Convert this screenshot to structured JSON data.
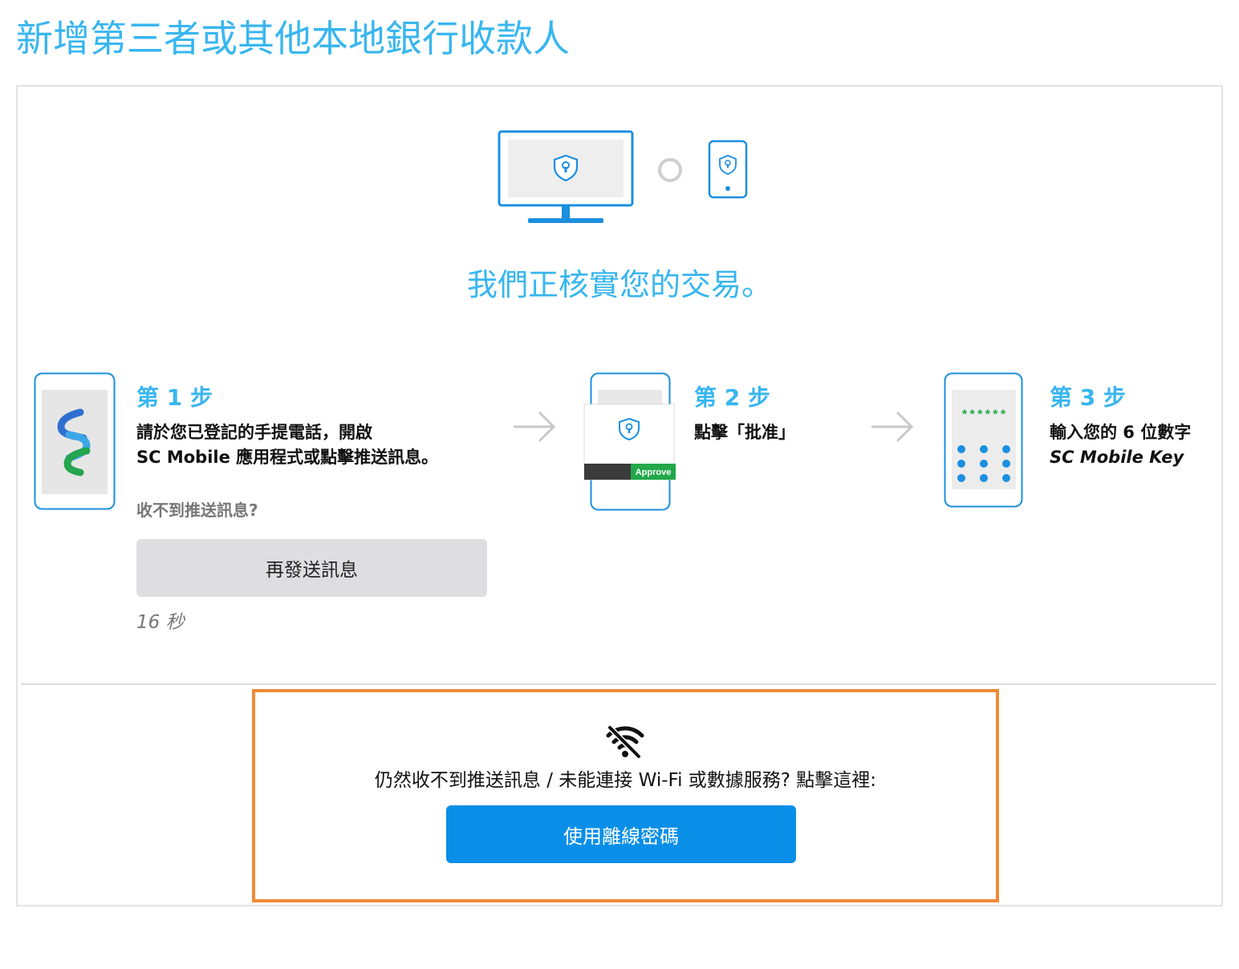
{
  "page": {
    "title": "新增第三者或其他本地銀行收款人"
  },
  "verification": {
    "heading": "我們正核實您的交易。"
  },
  "steps": [
    {
      "title": "第 1 步",
      "line1": "請於您已登記的手提電話，開啟",
      "line2": "SC Mobile 應用程式或點擊推送訊息。"
    },
    {
      "title": "第 2 步",
      "line1": "點擊「批准」",
      "approve_label": "Approve"
    },
    {
      "title": "第 3 步",
      "line1": "輸入您的 6 位數字",
      "line2": "SC Mobile Key",
      "pin_mask": "******"
    }
  ],
  "resend": {
    "prompt": "收不到推送訊息?",
    "button_label": "再發送訊息",
    "countdown": "16 秒"
  },
  "offline": {
    "text": "仍然收不到推送訊息 / 未能連接 Wi-Fi 或數據服務? 點擊這裡:",
    "button_label": "使用離線密碼"
  },
  "colors": {
    "brand_blue": "#38b6ef",
    "primary_button": "#0a8fe8",
    "highlight_border": "#f08a35",
    "approve_green": "#22a84a"
  },
  "icons": [
    "desktop-shield-icon",
    "phone-shield-icon",
    "sc-logo-icon",
    "arrow-right-icon",
    "wifi-off-icon"
  ]
}
